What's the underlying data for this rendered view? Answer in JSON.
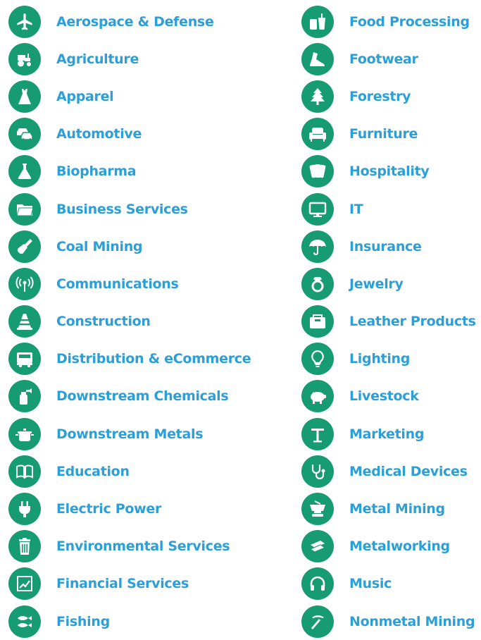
{
  "colors": {
    "icon_bg": "#179b72",
    "label": "#2b9fd7",
    "icon_fg": "#ffffff"
  },
  "columns": [
    {
      "items": [
        {
          "label": "Aerospace & Defense",
          "icon": "airplane-icon"
        },
        {
          "label": "Agriculture",
          "icon": "tractor-icon"
        },
        {
          "label": "Apparel",
          "icon": "dress-icon"
        },
        {
          "label": "Automotive",
          "icon": "cars-icon"
        },
        {
          "label": "Biopharma",
          "icon": "flask-icon"
        },
        {
          "label": "Business Services",
          "icon": "folder-icon"
        },
        {
          "label": "Coal Mining",
          "icon": "shovel-icon"
        },
        {
          "label": "Communications",
          "icon": "antenna-icon"
        },
        {
          "label": "Construction",
          "icon": "traffic-cone-icon"
        },
        {
          "label": "Distribution & eCommerce",
          "icon": "truck-icon"
        },
        {
          "label": "Downstream Chemicals",
          "icon": "spray-bottle-icon"
        },
        {
          "label": "Downstream Metals",
          "icon": "pot-icon"
        },
        {
          "label": "Education",
          "icon": "book-icon"
        },
        {
          "label": "Electric Power",
          "icon": "plug-icon"
        },
        {
          "label": "Environmental Services",
          "icon": "trash-can-icon"
        },
        {
          "label": "Financial Services",
          "icon": "chart-icon"
        },
        {
          "label": "Fishing",
          "icon": "fish-icon"
        }
      ]
    },
    {
      "items": [
        {
          "label": "Food Processing",
          "icon": "can-cup-icon"
        },
        {
          "label": "Footwear",
          "icon": "shoe-icon"
        },
        {
          "label": "Forestry",
          "icon": "tree-icon"
        },
        {
          "label": "Furniture",
          "icon": "sofa-icon"
        },
        {
          "label": "Hospitality",
          "icon": "towels-icon"
        },
        {
          "label": "IT",
          "icon": "monitor-icon"
        },
        {
          "label": "Insurance",
          "icon": "umbrella-icon"
        },
        {
          "label": "Jewelry",
          "icon": "ring-icon"
        },
        {
          "label": "Leather Products",
          "icon": "wallet-icon"
        },
        {
          "label": "Lighting",
          "icon": "lightbulb-icon"
        },
        {
          "label": "Livestock",
          "icon": "pig-icon"
        },
        {
          "label": "Marketing",
          "icon": "sign-icon"
        },
        {
          "label": "Medical Devices",
          "icon": "stethoscope-icon"
        },
        {
          "label": "Metal Mining",
          "icon": "mining-cart-icon"
        },
        {
          "label": "Metalworking",
          "icon": "metal-bars-icon"
        },
        {
          "label": "Music",
          "icon": "headphones-icon"
        },
        {
          "label": "Nonmetal Mining",
          "icon": "pickaxe-icon"
        }
      ]
    }
  ]
}
